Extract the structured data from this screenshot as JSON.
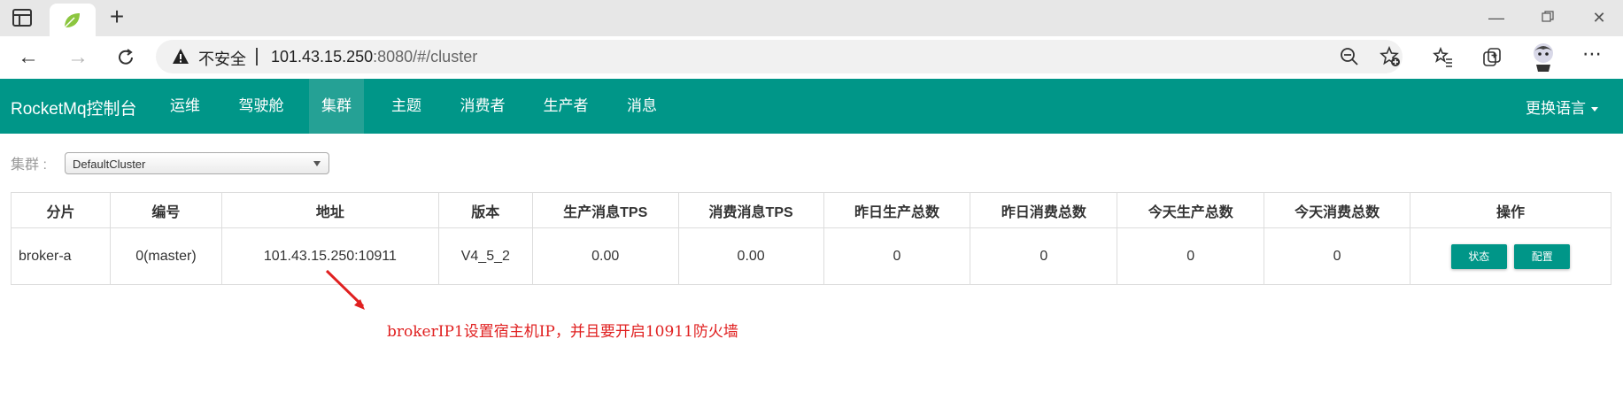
{
  "browser": {
    "new_tab_symbol": "+",
    "address": {
      "security_label": "不安全",
      "url_host": "101.43.15.250",
      "url_rest": ":8080/#/cluster"
    }
  },
  "app": {
    "brand": "RocketMq控制台",
    "nav": [
      {
        "label": "运维"
      },
      {
        "label": "驾驶舱"
      },
      {
        "label": "集群",
        "active": true
      },
      {
        "label": "主题"
      },
      {
        "label": "消费者"
      },
      {
        "label": "生产者"
      },
      {
        "label": "消息"
      }
    ],
    "language_label": "更换语言",
    "accent_color": "#009688"
  },
  "cluster": {
    "label": "集群 :",
    "selected": "DefaultCluster"
  },
  "table": {
    "headers": [
      "分片",
      "编号",
      "地址",
      "版本",
      "生产消息TPS",
      "消费消息TPS",
      "昨日生产总数",
      "昨日消费总数",
      "今天生产总数",
      "今天消费总数",
      "操作"
    ],
    "rows": [
      {
        "shard": "broker-a",
        "id": "0(master)",
        "address": "101.43.15.250:10911",
        "version": "V4_5_2",
        "produce_tps": "0.00",
        "consume_tps": "0.00",
        "yesterday_produce": "0",
        "yesterday_consume": "0",
        "today_produce": "0",
        "today_consume": "0",
        "status_button": "状态",
        "config_button": "配置"
      }
    ]
  },
  "annotation": {
    "text": "brokerIP1设置宿主机IP，并且要开启10911防火墙",
    "color": "#e02020"
  }
}
